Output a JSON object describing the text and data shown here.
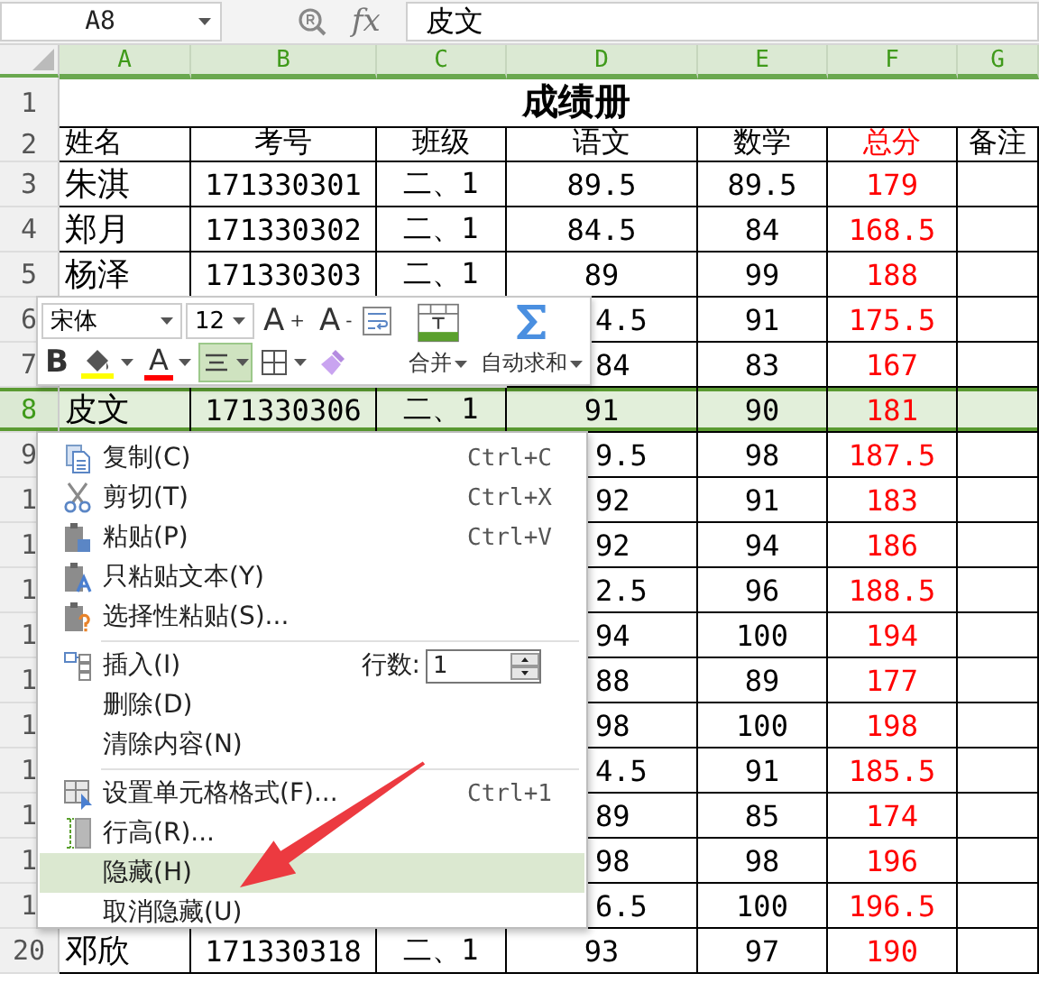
{
  "formula_bar": {
    "cell_ref": "A8",
    "fx": "fx",
    "value": "皮文"
  },
  "columns": [
    {
      "letter": "A",
      "color": "#000000"
    },
    {
      "letter": "B",
      "color": "#000000"
    },
    {
      "letter": "C",
      "color": "#000000"
    },
    {
      "letter": "D",
      "color": "#000000"
    },
    {
      "letter": "E",
      "color": "#000000"
    },
    {
      "letter": "F",
      "color": "#ff0000"
    },
    {
      "letter": "G",
      "color": "#000000"
    }
  ],
  "title_row": {
    "header": "1",
    "title": "成绩册"
  },
  "rows": [
    {
      "header": "2",
      "selected": false,
      "clip": false,
      "cells": [
        "姓名",
        "考号",
        "班级",
        "语文",
        "数学",
        "总分",
        "备注"
      ]
    },
    {
      "header": "3",
      "selected": false,
      "clip": false,
      "cells": [
        "朱淇",
        "171330301",
        "二、1",
        "89.5",
        "89.5",
        "179",
        null
      ]
    },
    {
      "header": "4",
      "selected": false,
      "clip": false,
      "cells": [
        "郑月",
        "171330302",
        "二、1",
        "84.5",
        "84",
        "168.5",
        null
      ]
    },
    {
      "header": "5",
      "selected": false,
      "clip": false,
      "cells": [
        "杨泽",
        "171330303",
        "二、1",
        "89",
        "99",
        "188",
        null
      ]
    },
    {
      "header": "6",
      "selected": false,
      "clip": true,
      "cells": [
        null,
        null,
        null,
        "4.5",
        "91",
        "175.5",
        null
      ]
    },
    {
      "header": "7",
      "selected": false,
      "clip": true,
      "cells": [
        null,
        null,
        null,
        "84",
        "83",
        "167",
        null
      ]
    },
    {
      "header": "8",
      "selected": true,
      "clip": false,
      "cells": [
        "皮文",
        "171330306",
        "二、1",
        "91",
        "90",
        "181",
        null
      ]
    },
    {
      "header": "9",
      "selected": false,
      "clip": true,
      "cells": [
        null,
        null,
        null,
        "9.5",
        "98",
        "187.5",
        null
      ]
    },
    {
      "header": "1",
      "selected": false,
      "clip": true,
      "cells": [
        null,
        null,
        null,
        "92",
        "91",
        "183",
        null
      ]
    },
    {
      "header": "1",
      "selected": false,
      "clip": true,
      "cells": [
        null,
        null,
        null,
        "92",
        "94",
        "186",
        null
      ]
    },
    {
      "header": "1",
      "selected": false,
      "clip": true,
      "cells": [
        null,
        null,
        null,
        "2.5",
        "96",
        "188.5",
        null
      ]
    },
    {
      "header": "1",
      "selected": false,
      "clip": true,
      "cells": [
        null,
        null,
        null,
        "94",
        "100",
        "194",
        null
      ]
    },
    {
      "header": "1",
      "selected": false,
      "clip": true,
      "cells": [
        null,
        null,
        null,
        "88",
        "89",
        "177",
        null
      ]
    },
    {
      "header": "1",
      "selected": false,
      "clip": true,
      "cells": [
        null,
        null,
        null,
        "98",
        "100",
        "198",
        null
      ]
    },
    {
      "header": "1",
      "selected": false,
      "clip": true,
      "cells": [
        null,
        null,
        null,
        "4.5",
        "91",
        "185.5",
        null
      ]
    },
    {
      "header": "1",
      "selected": false,
      "clip": true,
      "cells": [
        null,
        null,
        null,
        "89",
        "85",
        "174",
        null
      ]
    },
    {
      "header": "1",
      "selected": false,
      "clip": true,
      "cells": [
        null,
        null,
        null,
        "98",
        "98",
        "196",
        null
      ]
    },
    {
      "header": "1",
      "selected": false,
      "clip": true,
      "cells": [
        null,
        null,
        null,
        "6.5",
        "100",
        "196.5",
        null
      ]
    },
    {
      "header": "20",
      "selected": false,
      "clip": false,
      "cells": [
        "邓欣",
        "171330318",
        "二、1",
        "93",
        "97",
        "190",
        null
      ]
    }
  ],
  "mini_toolbar": {
    "font": "宋体",
    "size": "12",
    "grow": "A$^{+}$",
    "shrink": "A$^{-}$",
    "tools": [
      {
        "kind": "bold",
        "label": "B"
      },
      {
        "kind": "fill",
        "color": "#ffff00"
      },
      {
        "kind": "font-color",
        "label": "A",
        "color": "#ff0000"
      },
      {
        "kind": "align",
        "selected": true
      },
      {
        "kind": "borders"
      },
      {
        "kind": "painter"
      }
    ],
    "merge": "合并",
    "autosum": "自动求和"
  },
  "context_menu": {
    "items": [
      {
        "kind": "item",
        "label": "复制(C)",
        "shortcut": "Ctrl+C",
        "selected": false
      },
      {
        "kind": "item",
        "label": "剪切(T)",
        "shortcut": "Ctrl+X",
        "selected": false
      },
      {
        "kind": "item",
        "label": "粘贴(P)",
        "shortcut": "Ctrl+V",
        "selected": false
      },
      {
        "kind": "item",
        "label": "只粘贴文本(Y)",
        "selected": false
      },
      {
        "kind": "item",
        "label": "选择性粘贴(S)...",
        "selected": false
      },
      {
        "kind": "separator"
      },
      {
        "kind": "count",
        "label": "插入(I)",
        "count_label": "行数:",
        "value": "1",
        "selected": false
      },
      {
        "kind": "item",
        "label": "删除(D)",
        "selected": false
      },
      {
        "kind": "item",
        "label": "清除内容(N)",
        "selected": false
      },
      {
        "kind": "separator"
      },
      {
        "kind": "item",
        "label": "设置单元格格式(F)...",
        "shortcut": "Ctrl+1",
        "selected": false
      },
      {
        "kind": "item",
        "label": "行高(R)...",
        "selected": false
      },
      {
        "kind": "item",
        "label": "隐藏(H)",
        "selected": true
      },
      {
        "kind": "item",
        "label": "取消隐藏(U)",
        "selected": false
      }
    ]
  }
}
